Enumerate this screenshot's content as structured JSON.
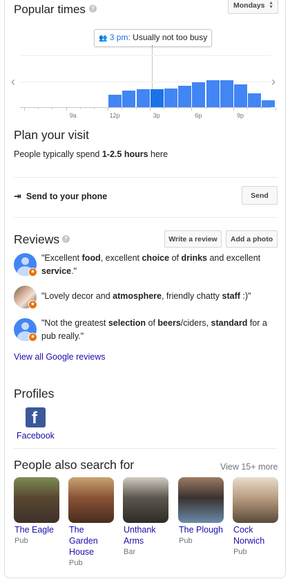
{
  "popular_times": {
    "title": "Popular times",
    "help": "?",
    "day_select": "Mondays",
    "tooltip_time": "3 pm:",
    "tooltip_status": "Usually not too busy",
    "prev": "‹",
    "next": "›",
    "hour_labels": [
      "9a",
      "12p",
      "3p",
      "6p",
      "9p"
    ],
    "busyness": [
      {
        "hour": "11a",
        "value": 0
      },
      {
        "hour": "12p",
        "value": 18
      },
      {
        "hour": "1p",
        "value": 24
      },
      {
        "hour": "2p",
        "value": 26
      },
      {
        "hour": "3p",
        "value": 26
      },
      {
        "hour": "4p",
        "value": 27
      },
      {
        "hour": "5p",
        "value": 31
      },
      {
        "hour": "6p",
        "value": 36
      },
      {
        "hour": "7p",
        "value": 39
      },
      {
        "hour": "8p",
        "value": 39
      },
      {
        "hour": "9p",
        "value": 33
      },
      {
        "hour": "10p",
        "value": 20
      },
      {
        "hour": "11p",
        "value": 10
      }
    ],
    "current_hour": "3p",
    "colors": {
      "bar": "#4285f4",
      "bar_current": "#1a73e8"
    }
  },
  "plan_visit": {
    "title": "Plan your visit",
    "prefix": "People typically spend ",
    "duration": "1-2.5 hours",
    "suffix": " here"
  },
  "send_phone": {
    "label": "Send to your phone",
    "button": "Send"
  },
  "reviews": {
    "title": "Reviews",
    "help": "?",
    "write_button": "Write a review",
    "photo_button": "Add a photo",
    "items": [
      {
        "avatar": "default-avatar-icon",
        "segments": [
          [
            "\"Excellent ",
            false
          ],
          [
            "food",
            true
          ],
          [
            ", excellent ",
            false
          ],
          [
            "choice",
            true
          ],
          [
            " of ",
            false
          ],
          [
            "drinks",
            true
          ],
          [
            " and excellent ",
            false
          ],
          [
            "service",
            true
          ],
          [
            ".\"",
            false
          ]
        ]
      },
      {
        "avatar": "photo-avatar",
        "segments": [
          [
            "\"Lovely decor and ",
            false
          ],
          [
            "atmosphere",
            true
          ],
          [
            ", friendly chatty ",
            false
          ],
          [
            "staff",
            true
          ],
          [
            " :)\"",
            false
          ]
        ]
      },
      {
        "avatar": "default-avatar-icon",
        "segments": [
          [
            "\"Not the greatest ",
            false
          ],
          [
            "selection",
            true
          ],
          [
            " of ",
            false
          ],
          [
            "beers",
            true
          ],
          [
            "/ciders, ",
            false
          ],
          [
            "standard",
            true
          ],
          [
            " for a pub really.\"",
            false
          ]
        ]
      }
    ],
    "view_all": "View all Google reviews"
  },
  "profiles": {
    "title": "Profiles",
    "items": [
      {
        "name": "Facebook",
        "icon": "facebook-icon",
        "color": "#3b5998"
      }
    ]
  },
  "also_search": {
    "title": "People also search for",
    "view_more": "View 15+ more",
    "places": [
      {
        "name": "The Eagle",
        "type": "Pub",
        "colors": [
          "#5a4632",
          "#7d8c52",
          "#3d3128"
        ]
      },
      {
        "name": "The Garden House",
        "type": "Pub",
        "colors": [
          "#8a5236",
          "#c9a472",
          "#4a2c1e"
        ]
      },
      {
        "name": "Unthank Arms",
        "type": "Bar",
        "colors": [
          "#5b564e",
          "#d2cbbf",
          "#2f2b26"
        ]
      },
      {
        "name": "The Plough",
        "type": "Pub",
        "colors": [
          "#3a3230",
          "#9c7b62",
          "#6a8aa8"
        ]
      },
      {
        "name": "Cock Norwich",
        "type": "Pub",
        "colors": [
          "#b99d80",
          "#e8dccb",
          "#5a4a3a"
        ]
      }
    ]
  }
}
